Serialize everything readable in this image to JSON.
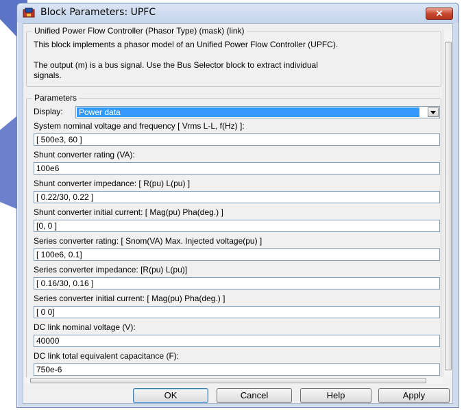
{
  "window": {
    "title": "Block Parameters: UPFC",
    "close_glyph": "✕",
    "icon": "simulink-block-icon"
  },
  "description": {
    "group_title": "Unified Power Flow Controller (Phasor Type) (mask) (link)",
    "line1": "This block implements a phasor model of an Unified Power Flow Controller (UPFC).",
    "line2": "The output (m) is a bus signal. Use the Bus Selector block to extract individual",
    "line3": "signals."
  },
  "parameters": {
    "group_title": "Parameters",
    "display_label": "Display:",
    "display_value": "Power data",
    "fields": [
      {
        "label": "System nominal voltage and frequency [ Vrms L-L, f(Hz) ]:",
        "value": "[ 500e3, 60 ]"
      },
      {
        "label": "Shunt converter rating (VA):",
        "value": "100e6"
      },
      {
        "label": "Shunt converter impedance: [ R(pu)  L(pu) ]",
        "value": "[ 0.22/30, 0.22 ]"
      },
      {
        "label": "Shunt converter initial current: [ Mag(pu)  Pha(deg.) ]",
        "value": "[0, 0 ]"
      },
      {
        "label": "Series converter rating: [ Snom(VA)   Max. Injected voltage(pu) ]",
        "value": "[ 100e6, 0.1]"
      },
      {
        "label": "Series  converter impedance: [R(pu)  L(pu)]",
        "value": "[ 0.16/30, 0.16 ]"
      },
      {
        "label": "Series converter initial current: [ Mag(pu)  Pha(deg.) ]",
        "value": "[ 0 0]"
      },
      {
        "label": "DC link nominal voltage (V):",
        "value": "40000"
      },
      {
        "label": "DC link total equivalent capacitance (F):",
        "value": "750e-6"
      }
    ]
  },
  "buttons": {
    "ok": "OK",
    "cancel": "Cancel",
    "help": "Help",
    "apply": "Apply"
  }
}
